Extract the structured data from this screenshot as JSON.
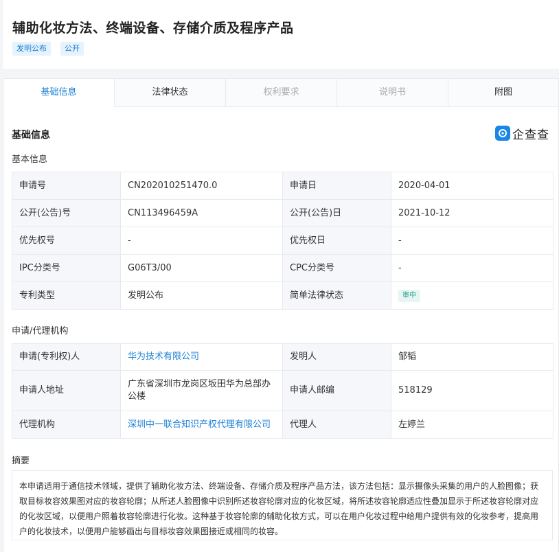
{
  "header": {
    "title": "辅助化妆方法、终端设备、存储介质及程序产品",
    "tags": [
      "发明公布",
      "公开"
    ]
  },
  "tabs": [
    {
      "label": "基础信息",
      "state": "active"
    },
    {
      "label": "法律状态",
      "state": "normal"
    },
    {
      "label": "权利要求",
      "state": "disabled"
    },
    {
      "label": "说明书",
      "state": "disabled"
    },
    {
      "label": "附图",
      "state": "normal"
    }
  ],
  "section": {
    "title": "基础信息",
    "logo_text": "企查查"
  },
  "basic_info": {
    "subtitle": "基本信息",
    "rows": [
      {
        "k1": "申请号",
        "v1": "CN202010251470.0",
        "k2": "申请日",
        "v2": "2020-04-01"
      },
      {
        "k1": "公开(公告)号",
        "v1": "CN113496459A",
        "k2": "公开(公告)日",
        "v2": "2021-10-12"
      },
      {
        "k1": "优先权号",
        "v1": "-",
        "k2": "优先权日",
        "v2": "-"
      },
      {
        "k1": "IPC分类号",
        "v1": "G06T3/00",
        "k2": "CPC分类号",
        "v2": "-"
      },
      {
        "k1": "专利类型",
        "v1": "发明公布",
        "k2": "简单法律状态",
        "v2": "审中"
      }
    ]
  },
  "agency": {
    "subtitle": "申请/代理机构",
    "rows": [
      {
        "k1": "申请(专利权)人",
        "v1": "华为技术有限公司",
        "k2": "发明人",
        "v2": "邹韬"
      },
      {
        "k1": "申请人地址",
        "v1": "广东省深圳市龙岗区坂田华为总部办公楼",
        "k2": "申请人邮编",
        "v2": "518129"
      },
      {
        "k1": "代理机构",
        "v1": "深圳中一联合知识产权代理有限公司",
        "k2": "代理人",
        "v2": "左婷兰"
      }
    ]
  },
  "abstract": {
    "subtitle": "摘要",
    "text": "本申请适用于通信技术领域，提供了辅助化妆方法、终端设备、存储介质及程序产品方法，该方法包括：显示摄像头采集的用户的人脸图像；获取目标妆容效果图对应的妆容轮廓；从所述人脸图像中识别所述妆容轮廓对应的化妆区域，将所述妆容轮廓适应性叠加显示于所述妆容轮廓对应的化妆区域，以便用户照着妆容轮廓进行化妆。这种基于妆容轮廓的辅助化妆方式，可以在用户化妆过程中给用户提供有效的化妆参考，提高用户的化妆技术，以便用户能够画出与目标妆容效果图接近或相同的妆容。"
  },
  "colors": {
    "accent": "#1a7fd6",
    "status_green": "#1a9a88",
    "label_bg": "#f5f7fa",
    "border": "#e6e9ee"
  }
}
